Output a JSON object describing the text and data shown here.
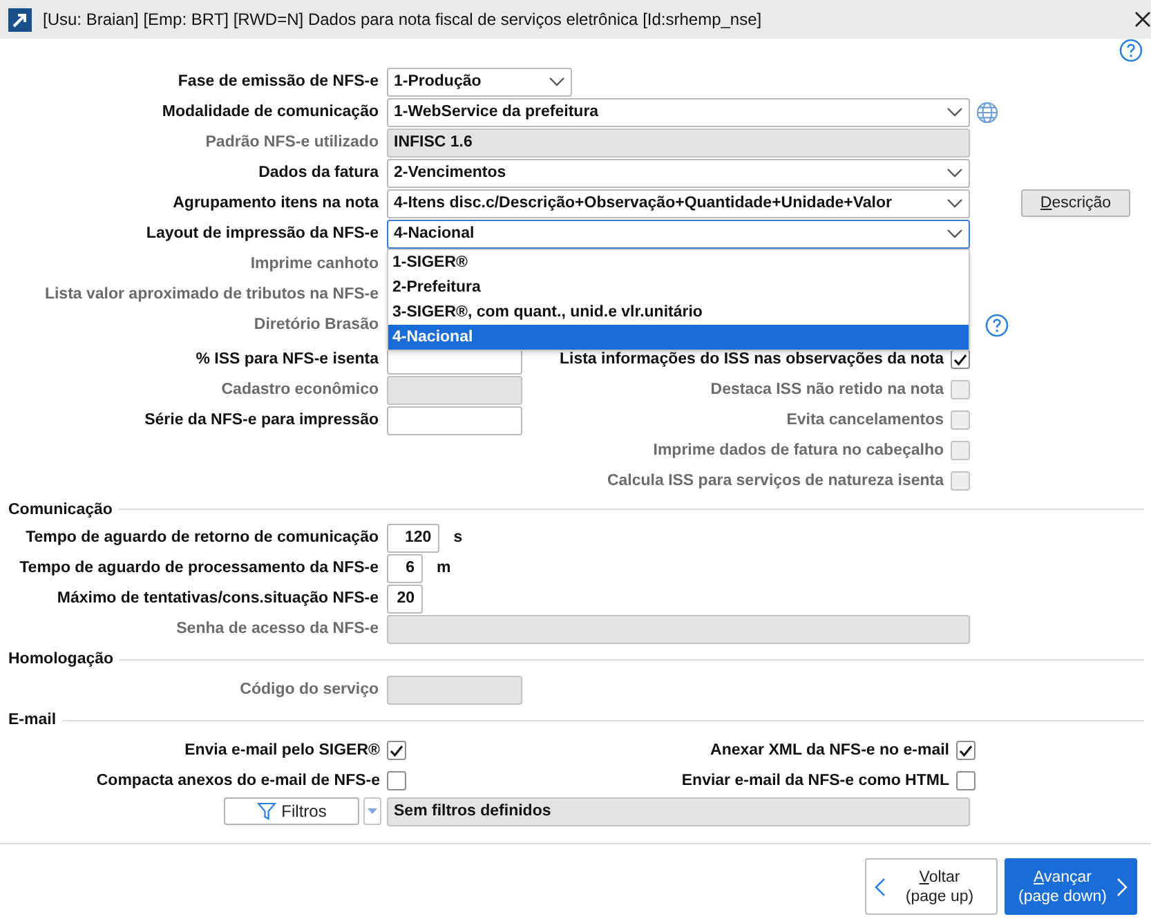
{
  "window": {
    "title": "[Usu: Braian] [Emp: BRT] [RWD=N] Dados para nota fiscal de serviços eletrônica [Id:srhemp_nse]"
  },
  "rows": [
    {
      "kind": "select",
      "label": "Fase de emissão de NFS-e",
      "value": "1-Produção",
      "disabled": false
    },
    {
      "kind": "select-web",
      "label": "Modalidade de comunicação",
      "value": "1-WebService da prefeitura",
      "disabled": false
    },
    {
      "kind": "text",
      "label": "Padrão NFS-e utilizado",
      "value": "INFISC 1.6",
      "disabled": true
    },
    {
      "kind": "select",
      "label": "Dados da fatura",
      "value": "2-Vencimentos",
      "disabled": false
    },
    {
      "kind": "select-button",
      "label": "Agrupamento itens na nota",
      "value": "4-Itens disc.c/Descrição+Observação+Quantidade+Unidade+Valor",
      "button": "Descrição",
      "disabled": false
    },
    {
      "kind": "select-open",
      "label": "Layout de impressão da NFS-e",
      "value": "4-Nacional",
      "disabled": false,
      "options": [
        {
          "label": "1-SIGER®",
          "selected": false
        },
        {
          "label": "2-Prefeitura",
          "selected": false
        },
        {
          "label": "3-SIGER®, com quant., unid.e vlr.unitário",
          "selected": false
        },
        {
          "label": "4-Nacional",
          "selected": true
        }
      ]
    },
    {
      "kind": "covered",
      "label": "Imprime canhoto",
      "disabled": true
    },
    {
      "kind": "covered",
      "label": "Lista valor aproximado de tributos na NFS-e",
      "disabled": true
    },
    {
      "kind": "covered-help",
      "label": "Diretório Brasão",
      "disabled": true
    }
  ],
  "split_fields": [
    {
      "label": "% ISS para NFS-e isenta",
      "disabled": false
    },
    {
      "label": "Cadastro econômico",
      "disabled": true
    },
    {
      "label": "Série da NFS-e para impressão",
      "disabled": false
    }
  ],
  "split_checks": [
    {
      "label": "Lista informações do ISS nas observações da nota",
      "checked": true,
      "disabled": false
    },
    {
      "label": "Destaca ISS não retido na nota",
      "checked": false,
      "disabled": true
    },
    {
      "label": "Evita cancelamentos",
      "checked": false,
      "disabled": true
    },
    {
      "label": "Imprime dados de fatura no cabeçalho",
      "checked": false,
      "disabled": true
    },
    {
      "label": "Calcula ISS para serviços de natureza isenta",
      "checked": false,
      "disabled": true
    }
  ],
  "comunicacao": {
    "title": "Comunicação",
    "rows": [
      {
        "kind": "number",
        "label": "Tempo de aguardo de retorno de comunicação",
        "value": "120",
        "unit": "s",
        "disabled": false
      },
      {
        "kind": "number",
        "label": "Tempo de aguardo de processamento da NFS-e",
        "value": "6",
        "unit": "m",
        "disabled": false
      },
      {
        "kind": "number",
        "label": "Máximo de tentativas/cons.situação NFS-e",
        "value": "20",
        "disabled": false
      },
      {
        "kind": "wide",
        "label": "Senha de acesso da NFS-e",
        "disabled": true
      }
    ]
  },
  "homologacao": {
    "title": "Homologação",
    "rows": [
      {
        "kind": "medium",
        "label": "Código do serviço",
        "disabled": true
      }
    ]
  },
  "email": {
    "title": "E-mail",
    "checks": [
      {
        "label": "Envia e-mail pelo SIGER®",
        "checked": true
      },
      {
        "label": "Anexar XML da NFS-e no e-mail",
        "checked": true
      },
      {
        "label": "Compacta anexos do e-mail de NFS-e",
        "checked": false
      },
      {
        "label": "Enviar e-mail da NFS-e como HTML",
        "checked": false
      }
    ],
    "filter": {
      "button": "Filtros",
      "value": "Sem filtros definidos"
    }
  },
  "footer": {
    "buttons": [
      {
        "kind": "back",
        "label": "Voltar",
        "hint": "(page up)",
        "primary": false
      },
      {
        "kind": "next",
        "label": "Avançar",
        "hint": "(page down)",
        "primary": true
      }
    ]
  }
}
